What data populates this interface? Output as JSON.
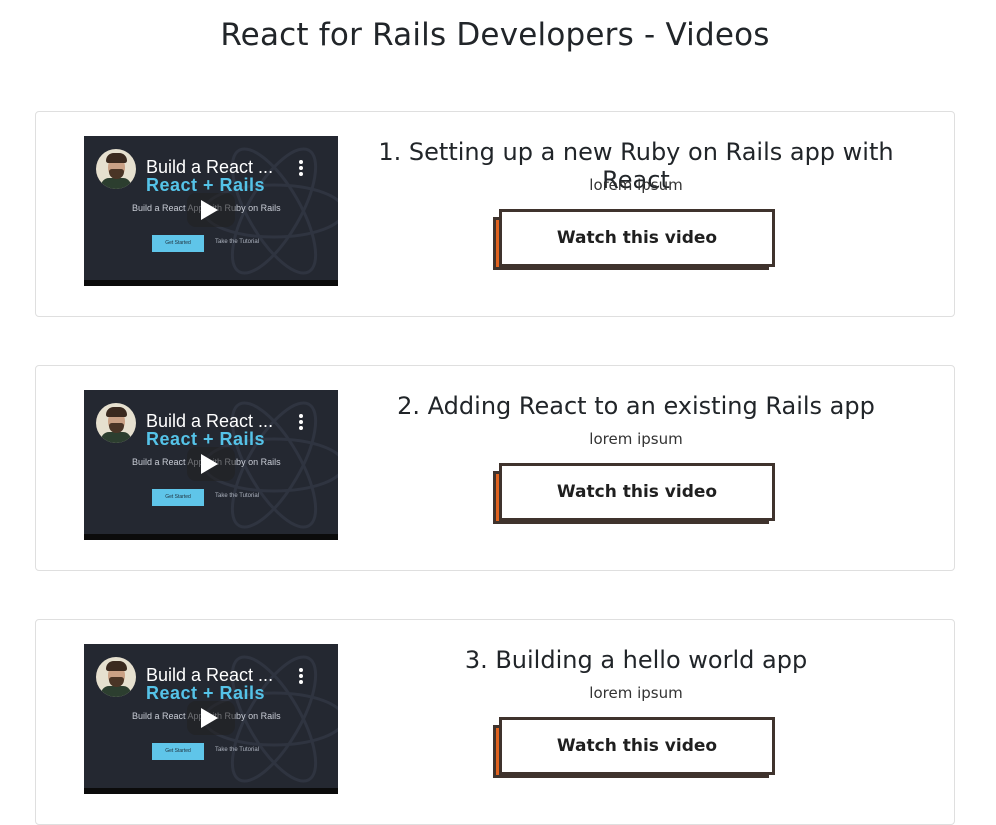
{
  "page": {
    "title": "React for Rails Developers - Videos"
  },
  "videos": [
    {
      "title": "1. Setting up a new Ruby on Rails app with React",
      "description": "lorem ipsum",
      "button_label": "Watch this video",
      "thumbnail": {
        "title": "Build a React ...",
        "brand": "React + Rails",
        "subtitle": "Build a React App with Ruby on Rails",
        "primary_cta": "Get Started",
        "secondary_cta": "Take the Tutorial"
      }
    },
    {
      "title": "2. Adding React to an existing Rails app",
      "description": "lorem ipsum",
      "button_label": "Watch this video",
      "thumbnail": {
        "title": "Build a React ...",
        "brand": "React + Rails",
        "subtitle": "Build a React App with Ruby on Rails",
        "primary_cta": "Get Started",
        "secondary_cta": "Take the Tutorial"
      }
    },
    {
      "title": "3. Building a hello world app",
      "description": "lorem ipsum",
      "button_label": "Watch this video",
      "thumbnail": {
        "title": "Build a React ...",
        "brand": "React + Rails",
        "subtitle": "Build a React App with Ruby on Rails",
        "primary_cta": "Get Started",
        "secondary_cta": "Take the Tutorial"
      }
    }
  ],
  "colors": {
    "button_shadow": "#e0621f",
    "button_border": "#3f332d",
    "thumb_bg": "#242831",
    "brand": "#55c3e8"
  }
}
